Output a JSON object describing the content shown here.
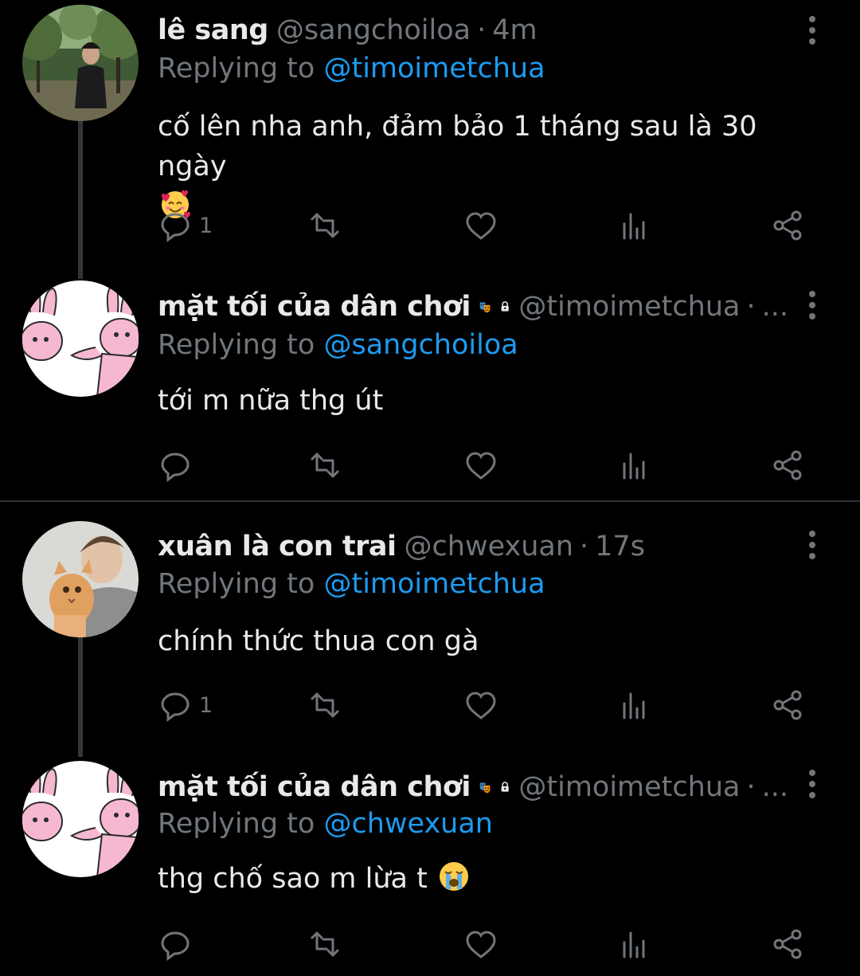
{
  "tweets": [
    {
      "name": "lê sang",
      "handle": "@sangchoiloa",
      "dot": "·",
      "time": "4m",
      "replying_prefix": "Replying to",
      "replying_handle": "@timoimetchua",
      "text": "cố lên nha anh, đảm bảo 1 tháng sau là 30 ngày",
      "emoji": "smiling-face-with-hearts",
      "reply_count": "1",
      "avatar": "photo-man-in-park"
    },
    {
      "name": "mặt tối của dân chơi",
      "handle": "@timoimetchua",
      "dot": "·",
      "time": "...",
      "replying_prefix": "Replying to",
      "replying_handle": "@sangchoiloa",
      "text": "tới m nữa thg út",
      "reply_count": "",
      "avatar": "pink-bunnies-illustration"
    },
    {
      "name": "xuân là con trai",
      "handle": "@chwexuan",
      "dot": "·",
      "time": "17s",
      "replying_prefix": "Replying to",
      "replying_handle": "@timoimetchua",
      "text": "chính thức thua con gà",
      "reply_count": "1",
      "avatar": "photo-person-with-cat"
    },
    {
      "name": "mặt tối của dân chơi",
      "handle": "@timoimetchua",
      "dot": "·",
      "time": "...",
      "replying_prefix": "Replying to",
      "replying_handle": "@chwexuan",
      "text": "thg chố sao m lừa t",
      "emoji": "loudly-crying-face",
      "reply_count": "",
      "avatar": "pink-bunnies-illustration"
    }
  ],
  "icons": {
    "reply": "reply-icon",
    "retweet": "retweet-icon",
    "like": "like-heart-icon",
    "views": "views-chart-icon",
    "share": "share-icon",
    "more": "more-options-icon",
    "badge_mask": "performing-arts-emoji",
    "badge_lock": "lock-icon"
  },
  "colors": {
    "background": "#000000",
    "text": "#e7e9ea",
    "muted": "#71767b",
    "link": "#1d9bf0",
    "divider": "#2f3336",
    "thread_line": "#333639"
  }
}
